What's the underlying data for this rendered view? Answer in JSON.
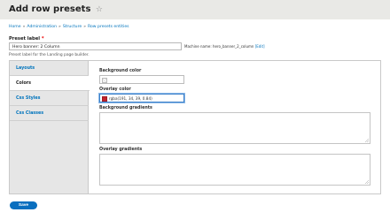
{
  "header": {
    "title": "Add row presets",
    "star_icon": "☆"
  },
  "breadcrumb": [
    "Home",
    "Administration",
    "Structure",
    "Row presets entities"
  ],
  "form": {
    "preset_label": {
      "label": "Preset label",
      "required": "*",
      "value": "Hero banner: 2 Column",
      "description": "Preset label for the Landing page builder."
    },
    "machine_name": {
      "text": "Machine name: hero_banner_2_column",
      "edit": "[Edit]"
    }
  },
  "tabs": [
    "Layouts",
    "Colors",
    "Css Styles",
    "Css Classes"
  ],
  "active_tab": "Colors",
  "colors_pane": {
    "background_color": {
      "label": "Background color",
      "value": ""
    },
    "overlay_color": {
      "label": "Overlay color",
      "value": "rgba(191, 34, 39, 0.84)",
      "swatch": "#c1222c"
    },
    "background_gradients": {
      "label": "Background gradients"
    },
    "overlay_gradients": {
      "label": "Overlay gradients"
    }
  },
  "actions": {
    "save": "Save"
  },
  "colors": {
    "link": "#0074bd",
    "primary_button": "#0a6fbf",
    "header_bg": "#e9e9e6"
  }
}
